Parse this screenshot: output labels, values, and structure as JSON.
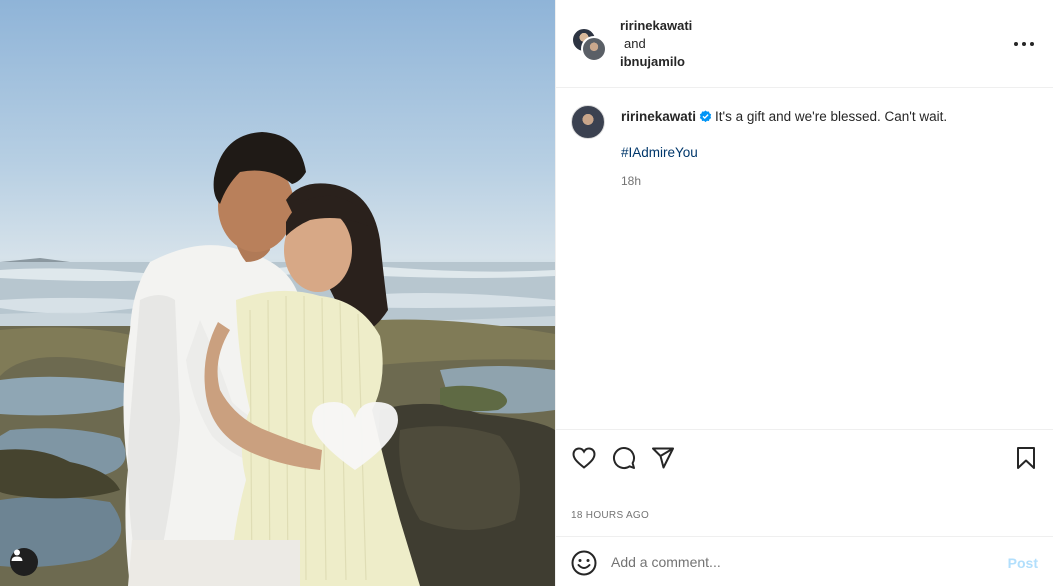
{
  "post": {
    "header": {
      "user1": "ririnekawati",
      "connector": "and",
      "user2": "ibnujamilo",
      "more_icon": "more-horizontal-icon"
    },
    "caption": {
      "username": "ririnekawati",
      "verified": true,
      "text": "It's a gift and we're blessed. Can't wait.",
      "hashtag": "#IAdmireYou",
      "time_ago": "18h"
    },
    "actions": {
      "like_icon": "heart-icon",
      "comment_icon": "comment-icon",
      "share_icon": "paper-plane-icon",
      "save_icon": "bookmark-icon"
    },
    "date_label": "18 HOURS AGO",
    "comment_box": {
      "emoji_icon": "emoji-icon",
      "placeholder": "Add a comment...",
      "post_label": "Post"
    },
    "photo": {
      "tag_icon": "user-tag-icon",
      "accent_colors": {
        "sky": "#9dbcdc",
        "sea": "#b9c9d2",
        "rock": "#4c4a3a",
        "dress": "#eeedc9",
        "shirt": "#f4f4f2"
      }
    }
  },
  "colors": {
    "hashtag": "#00376b",
    "verified": "#0095f6",
    "muted": "#737373",
    "post_disabled": "#b2dffc"
  }
}
